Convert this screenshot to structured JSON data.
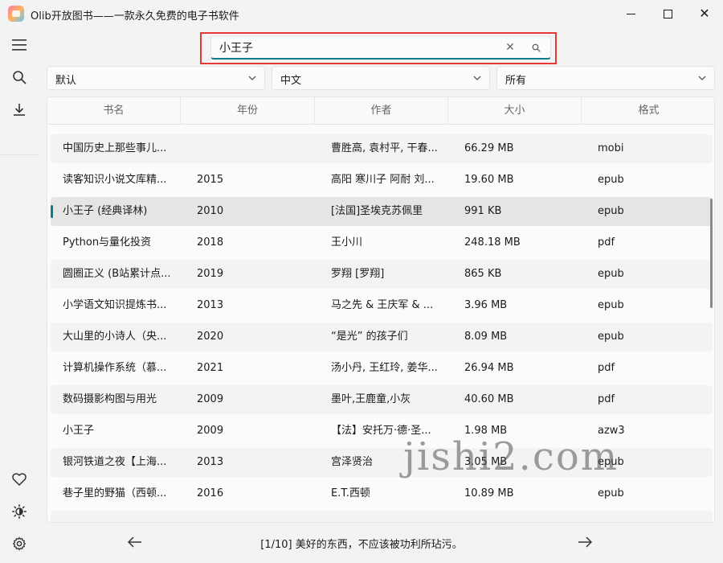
{
  "window": {
    "title": "Olib开放图书——一款永久免费的电子书软件",
    "minimize_icon": "minimize-icon",
    "maximize_icon": "maximize-icon",
    "close_icon": "close-icon"
  },
  "sidebar": {
    "items": [
      {
        "name": "menu",
        "icon": "hamburger-menu-icon"
      },
      {
        "name": "search",
        "icon": "search-icon"
      },
      {
        "name": "download",
        "icon": "download-icon"
      },
      {
        "name": "favorite",
        "icon": "heart-icon"
      },
      {
        "name": "theme",
        "icon": "brightness-icon"
      },
      {
        "name": "settings",
        "icon": "gear-icon"
      }
    ]
  },
  "search": {
    "value": "小王子",
    "placeholder": "",
    "clear_icon": "clear-icon",
    "submit_icon": "search-icon"
  },
  "filters": [
    {
      "name": "sort",
      "value": "默认"
    },
    {
      "name": "language",
      "value": "中文"
    },
    {
      "name": "format",
      "value": "所有"
    }
  ],
  "table": {
    "columns": [
      "书名",
      "年份",
      "作者",
      "大小",
      "格式"
    ],
    "rows": [
      {
        "title": "中国历史上那些事儿...",
        "year": "",
        "author": "曹胜高, 袁村平, 干春...",
        "size": "66.29 MB",
        "format": "mobi"
      },
      {
        "title": "读客知识小说文库精...",
        "year": "2015",
        "author": "高阳 寒川子 阿耐 刘...",
        "size": "19.60 MB",
        "format": "epub"
      },
      {
        "title": "小王子 (经典译林)",
        "year": "2010",
        "author": "[法国]圣埃克苏佩里",
        "size": "991 KB",
        "format": "epub"
      },
      {
        "title": "Python与量化投资",
        "year": "2018",
        "author": "王小川",
        "size": "248.18 MB",
        "format": "pdf"
      },
      {
        "title": "圆圈正义 (B站累计点...",
        "year": "2019",
        "author": "罗翔 [罗翔]",
        "size": "865 KB",
        "format": "epub"
      },
      {
        "title": "小学语文知识提炼书...",
        "year": "2013",
        "author": "马之先 & 王庆军 & ...",
        "size": "3.96 MB",
        "format": "epub"
      },
      {
        "title": "大山里的小诗人（央...",
        "year": "2020",
        "author": "“是光” 的孩子们",
        "size": "8.09 MB",
        "format": "epub"
      },
      {
        "title": "计算机操作系统（慕...",
        "year": "2021",
        "author": "汤小丹, 王红玲, 姜华...",
        "size": "26.94 MB",
        "format": "pdf"
      },
      {
        "title": "数码摄影构图与用光",
        "year": "2009",
        "author": "墨叶,王鹿童,小灰",
        "size": "40.60 MB",
        "format": "pdf"
      },
      {
        "title": "小王子",
        "year": "2009",
        "author": "【法】安托万·德·圣...",
        "size": "1.98 MB",
        "format": "azw3"
      },
      {
        "title": "银河铁道之夜【上海...",
        "year": "2013",
        "author": "宫泽贤治",
        "size": "3.05 MB",
        "format": "epub"
      },
      {
        "title": "巷子里的野猫（西顿...",
        "year": "2016",
        "author": "E.T.西顿",
        "size": "10.89 MB",
        "format": "epub"
      },
      {
        "title": "",
        "year": "",
        "author": "",
        "size": "",
        "format": ""
      }
    ],
    "selected_index": 2
  },
  "footer": {
    "prev_icon": "arrow-left-icon",
    "next_icon": "arrow-right-icon",
    "quote": "[1/10] 美好的东西，不应该被功利所玷污。"
  },
  "watermark": "jishi2.com"
}
